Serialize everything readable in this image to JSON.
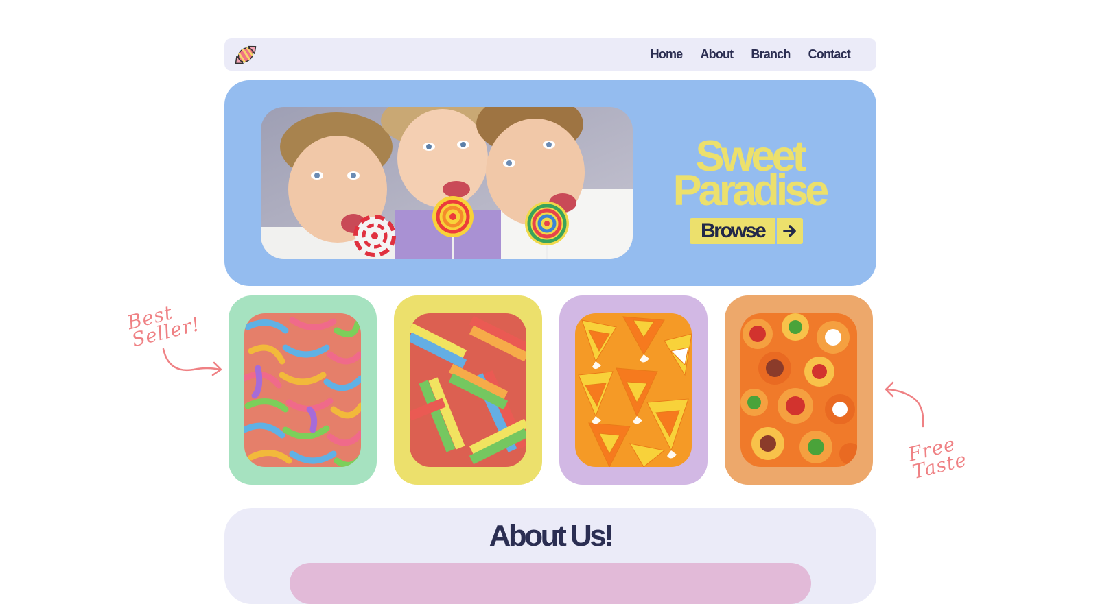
{
  "nav": {
    "logo_icon": "candy-icon",
    "links": [
      "Home",
      "About",
      "Branch",
      "Contact"
    ]
  },
  "hero": {
    "title_line1": "Sweet",
    "title_line2": "Paradise",
    "browse_label": "Browse",
    "browse_icon": "arrow-right-icon",
    "image": "children-with-lollipops-photo"
  },
  "products": [
    {
      "image": "sour-gummy-worms-photo",
      "color": "#a6e2c0"
    },
    {
      "image": "sour-rainbow-belts-photo",
      "color": "#ece06c"
    },
    {
      "image": "candy-corn-photo",
      "color": "#d2b8e4"
    },
    {
      "image": "gummy-burgers-photo",
      "color": "#eda86b"
    }
  ],
  "annotations": {
    "left_line1": "Best",
    "left_line2": "Seller!",
    "right_line1": "Free",
    "right_line2": "Taste"
  },
  "about": {
    "title": "About Us!"
  },
  "colors": {
    "nav_bg": "#ebebf8",
    "hero_bg": "#94bcef",
    "accent_yellow": "#ece06c",
    "text_dark": "#2b2e52",
    "annotation": "#ef8184"
  }
}
